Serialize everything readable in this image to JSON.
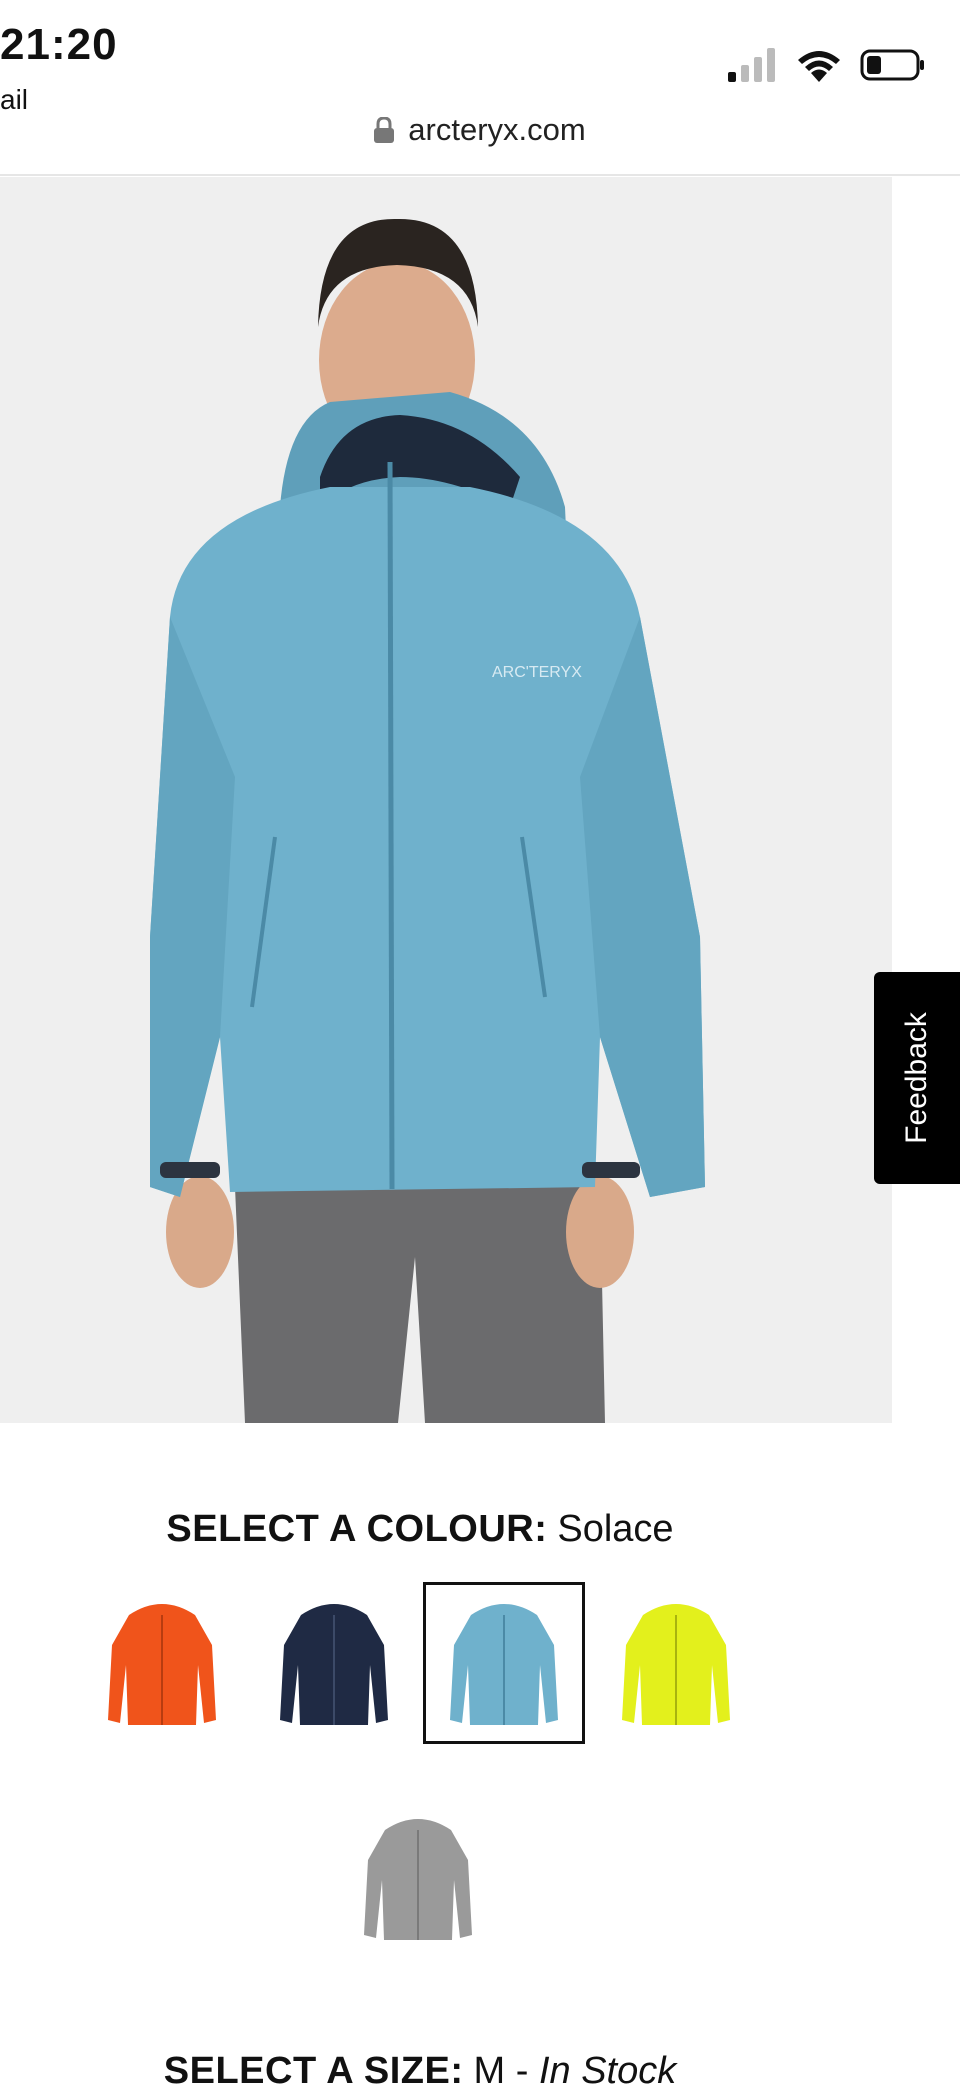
{
  "status_bar": {
    "time": "21:20",
    "carrier": "ail",
    "signal_icon": "signal-bars-icon",
    "wifi_icon": "wifi-icon",
    "battery_icon": "battery-low-icon"
  },
  "browser": {
    "lock_icon": "lock-icon",
    "url": "arcteryx.com"
  },
  "product": {
    "hero_image": "jacket-model-photo",
    "jacket_color": "#6fb1cc",
    "feedback_label": "Feedback"
  },
  "colour_selector": {
    "label": "SELECT A COLOUR:",
    "selected": "Solace",
    "swatches": [
      {
        "name": "orange",
        "color": "#f0541b"
      },
      {
        "name": "navy",
        "color": "#1f2a44"
      },
      {
        "name": "solace",
        "color": "#6fb1cc"
      },
      {
        "name": "lime",
        "color": "#e3f01c"
      },
      {
        "name": "grey",
        "color": "#9a9a9a"
      }
    ]
  },
  "size_selector": {
    "label": "SELECT A SIZE:",
    "size": "M -",
    "availability": "In Stock"
  }
}
